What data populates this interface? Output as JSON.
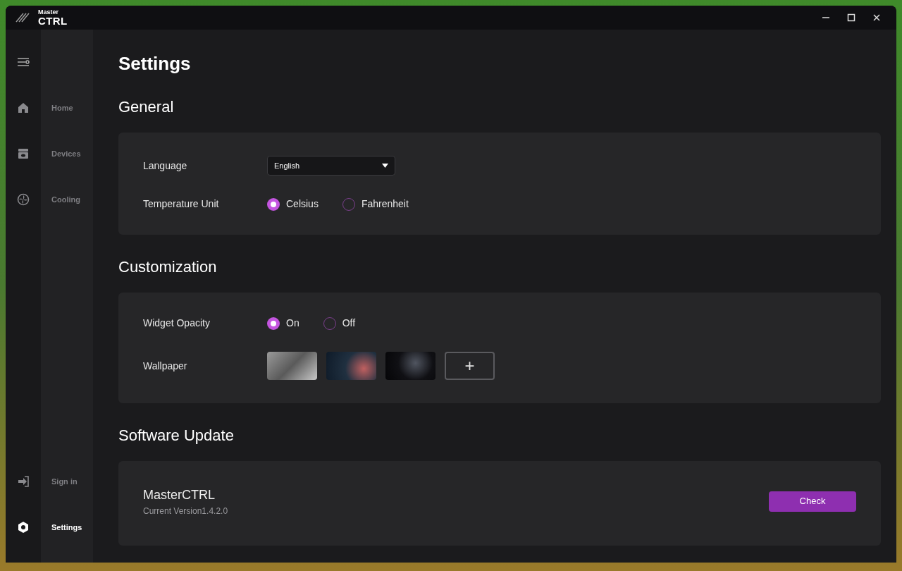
{
  "window": {
    "logo": {
      "line_1": "Master",
      "line_2": "CTRL"
    }
  },
  "nav": {
    "top": [
      {
        "kind": "home",
        "label": "Home",
        "selected": false
      },
      {
        "kind": "devices",
        "label": "Devices",
        "selected": false
      },
      {
        "kind": "cooling",
        "label": "Cooling",
        "selected": false
      }
    ],
    "bottom": [
      {
        "kind": "signin",
        "label": "Sign in",
        "selected": false
      },
      {
        "kind": "settings",
        "label": "Settings",
        "selected": true
      }
    ]
  },
  "page_title": "Settings",
  "sections": [
    {
      "title": "General",
      "rows": [
        {
          "kind": "dropdown",
          "label": "Language",
          "value": "English"
        },
        {
          "kind": "radio",
          "label": "Temperature Unit",
          "options": [
            {
              "label": "Celsius",
              "selected": true
            },
            {
              "label": "Fahrenheit",
              "selected": false
            }
          ]
        }
      ]
    },
    {
      "title": "Customization",
      "rows": [
        {
          "kind": "radio",
          "label": "Widget Opacity",
          "options": [
            {
              "label": "On",
              "selected": true
            },
            {
              "label": "Off",
              "selected": false
            }
          ]
        },
        {
          "kind": "wallpapers",
          "label": "Wallpaper",
          "thumbnails": [
            {
              "kind": "grey"
            },
            {
              "kind": "bokeh"
            },
            {
              "kind": "dark"
            }
          ],
          "add_label": "+"
        }
      ]
    }
  ],
  "software_update": {
    "title": "Software Update",
    "app_name": "MasterCTRL",
    "version": "Current Version1.4.2.0",
    "button": "Check"
  }
}
